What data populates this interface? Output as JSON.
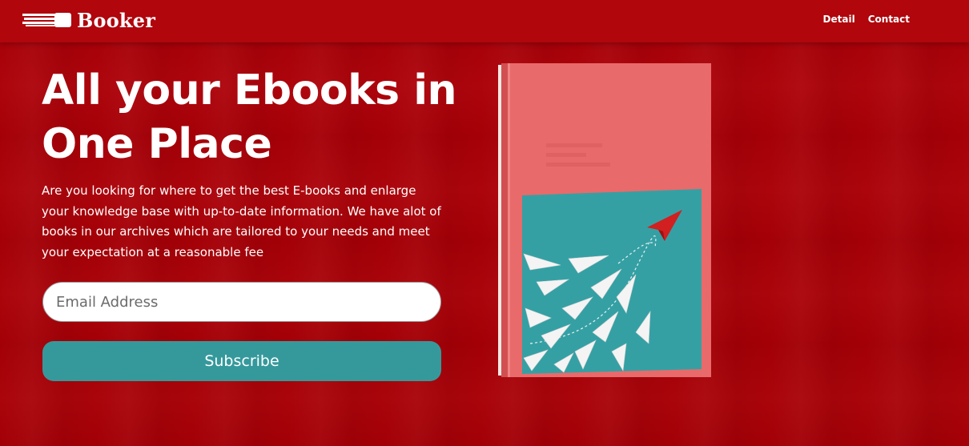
{
  "header": {
    "brand": "Booker",
    "nav": [
      {
        "label": "Detail"
      },
      {
        "label": "Contact"
      }
    ]
  },
  "hero": {
    "title_line1": "All your Ebooks in",
    "title_line2": "One Place",
    "description": "Are you looking for where to get the best E-books and enlarge your knowledge base with up-to-date information. We have alot of books in our archives which are tailored to your needs and meet your expectation at a reasonable fee",
    "email_placeholder": "Email Address",
    "subscribe_label": "Subscribe"
  },
  "colors": {
    "background": "#a80006",
    "header": "#b0060c",
    "subscribe_button": "#35999c",
    "book_cover": "#e96a6a",
    "book_panel": "#35a0a4",
    "plane_highlight": "#d21f1f"
  },
  "icons": {
    "logo": "book-stack-icon",
    "book": "book-cover-paper-planes-illustration"
  }
}
